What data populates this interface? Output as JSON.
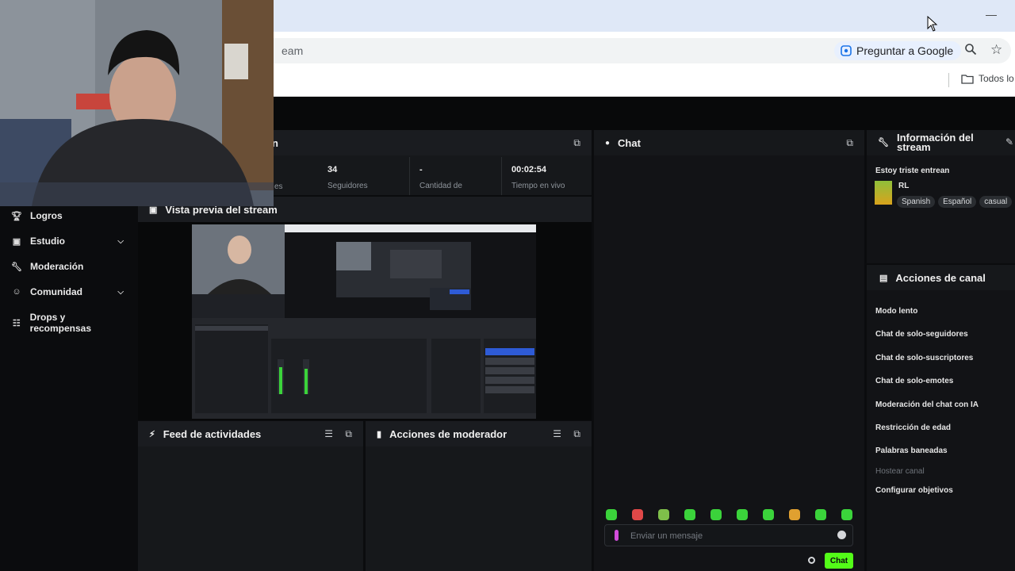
{
  "browser": {
    "url_fragment": "eam",
    "ask_google": "Preguntar a Google",
    "bookmarks_all": "Todos lo",
    "minimize": "—"
  },
  "sidebar": {
    "items": [
      {
        "label": "Logros",
        "icon": "trophy-icon"
      },
      {
        "label": "Estudio",
        "icon": "studio-icon",
        "expandable": true
      },
      {
        "label": "Moderación",
        "icon": "wrench-icon"
      },
      {
        "label": "Comunidad",
        "icon": "people-icon",
        "expandable": true
      },
      {
        "label": "Drops y recompensas",
        "icon": "gift-icon"
      }
    ]
  },
  "stats_panel": {
    "title_fragment": "n",
    "stats": [
      {
        "value": "",
        "label": "es"
      },
      {
        "value": "34",
        "label": "Seguidores"
      },
      {
        "value": "-",
        "label": "Cantidad de"
      },
      {
        "value": "00:02:54",
        "label": "Tiempo en vivo"
      }
    ]
  },
  "preview_panel": {
    "title": "Vista previa del stream"
  },
  "activity_panel": {
    "title": "Feed de actividades"
  },
  "mod_actions_panel": {
    "title": "Acciones de moderador"
  },
  "chat": {
    "title": "Chat",
    "input_placeholder": "Enviar un mensaje",
    "send_label": "Chat",
    "emote_count": 10
  },
  "stream_info": {
    "title": "Información del stream",
    "stream_title": "Estoy triste entrean",
    "category": "RL",
    "tags": [
      "Spanish",
      "Español",
      "casual"
    ]
  },
  "channel_actions": {
    "title": "Acciones de canal",
    "items": [
      {
        "label": "Modo lento",
        "enabled": true
      },
      {
        "label": "Chat de solo-seguidores",
        "enabled": true
      },
      {
        "label": "Chat de solo-suscriptores",
        "enabled": true
      },
      {
        "label": "Chat de solo-emotes",
        "enabled": true
      },
      {
        "label": "Moderación del chat con IA",
        "enabled": true
      },
      {
        "label": "Restricción de edad",
        "enabled": true
      },
      {
        "label": "Palabras baneadas",
        "enabled": true
      },
      {
        "label": "Hostear canal",
        "enabled": false
      },
      {
        "label": "Configurar objetivos",
        "enabled": true
      }
    ]
  },
  "colors": {
    "accent": "#53fc18",
    "panel": "#16181b",
    "background": "#0b0c0e"
  }
}
